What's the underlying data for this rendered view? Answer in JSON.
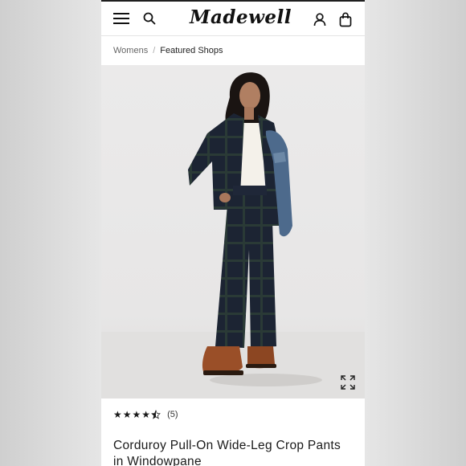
{
  "header": {
    "brand": "Madewell"
  },
  "breadcrumb": {
    "items": [
      "Womens",
      "Featured Shops"
    ],
    "separator": "/"
  },
  "product": {
    "rating_value": 4.5,
    "review_count": "(5)",
    "title": "Corduroy Pull-On Wide-Leg Crop Pants in Windowpane"
  },
  "colors": {
    "outfit_navy": "#1c2433",
    "plaid_green": "#2a3a36",
    "denim": "#4d6a8c",
    "boots": "#9a4f28",
    "camisole": "#f4f1ea"
  }
}
